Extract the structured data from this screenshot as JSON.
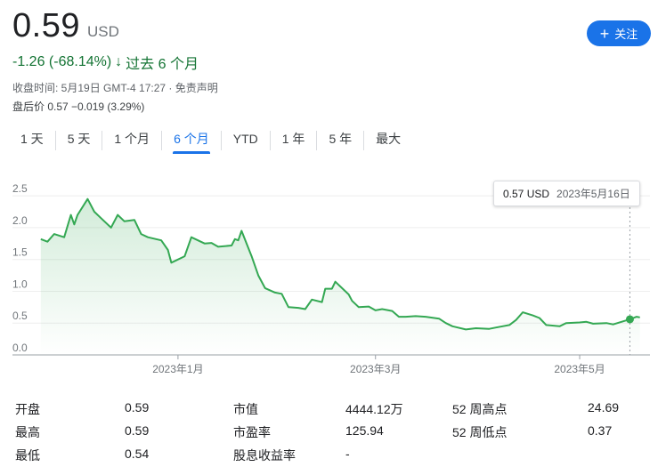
{
  "header": {
    "price": "0.59",
    "currency": "USD",
    "change": "-1.26 (-68.14%)",
    "change_arrow": "↓",
    "change_period": "过去 6 个月",
    "follow_label": "关注",
    "follow_icon": "plus-icon",
    "closing_time": "收盘时间: 5月19日 GMT-4 17:27 · 免责声明",
    "after_hours": "盘后价 0.57 −0.019 (3.29%)"
  },
  "tabs": [
    {
      "label": "1 天",
      "active": false
    },
    {
      "label": "5 天",
      "active": false
    },
    {
      "label": "1 个月",
      "active": false
    },
    {
      "label": "6 个月",
      "active": true
    },
    {
      "label": "YTD",
      "active": false
    },
    {
      "label": "1 年",
      "active": false
    },
    {
      "label": "5 年",
      "active": false
    },
    {
      "label": "最大",
      "active": false
    }
  ],
  "tooltip": {
    "price": "0.57 USD",
    "date": "2023年5月16日"
  },
  "colors": {
    "accent": "#1a73e8",
    "line": "#34a853",
    "positive": "#137333"
  },
  "chart_data": {
    "type": "area",
    "ylim": [
      0,
      2.6
    ],
    "y_ticks": [
      "0.0",
      "0.5",
      "1.0",
      "1.5",
      "2.0",
      "2.5"
    ],
    "x_tick_labels": [
      "2023年1月",
      "2023年3月",
      "2023年5月"
    ],
    "series": [
      {
        "x": [
          "2022-11-21",
          "2022-11-23",
          "2022-11-25",
          "2022-11-28",
          "2022-11-30",
          "2022-12-01",
          "2022-12-02",
          "2022-12-05",
          "2022-12-07",
          "2022-12-09",
          "2022-12-12",
          "2022-12-14",
          "2022-12-16",
          "2022-12-19",
          "2022-12-21",
          "2022-12-23",
          "2022-12-27",
          "2022-12-29",
          "2022-12-30",
          "2023-01-03",
          "2023-01-05",
          "2023-01-09",
          "2023-01-11",
          "2023-01-13",
          "2023-01-17",
          "2023-01-18",
          "2023-01-19",
          "2023-01-20",
          "2023-01-23",
          "2023-01-25",
          "2023-01-27",
          "2023-01-30",
          "2023-02-01",
          "2023-02-03",
          "2023-02-06",
          "2023-02-08",
          "2023-02-10",
          "2023-02-13",
          "2023-02-14",
          "2023-02-16",
          "2023-02-17",
          "2023-02-21",
          "2023-02-22",
          "2023-02-24",
          "2023-02-27",
          "2023-03-01",
          "2023-03-03",
          "2023-03-06",
          "2023-03-08",
          "2023-03-10",
          "2023-03-13",
          "2023-03-16",
          "2023-03-20",
          "2023-03-22",
          "2023-03-24",
          "2023-03-28",
          "2023-03-31",
          "2023-04-04",
          "2023-04-06",
          "2023-04-10",
          "2023-04-12",
          "2023-04-14",
          "2023-04-17",
          "2023-04-19",
          "2023-04-21",
          "2023-04-25",
          "2023-04-27",
          "2023-05-01",
          "2023-05-03",
          "2023-05-05",
          "2023-05-09",
          "2023-05-11",
          "2023-05-16",
          "2023-05-18",
          "2023-05-19"
        ],
        "y": [
          1.82,
          1.78,
          1.9,
          1.85,
          2.2,
          2.05,
          2.2,
          2.45,
          2.25,
          2.15,
          2.0,
          2.2,
          2.1,
          2.12,
          1.9,
          1.85,
          1.8,
          1.65,
          1.45,
          1.55,
          1.85,
          1.75,
          1.76,
          1.7,
          1.72,
          1.82,
          1.8,
          1.95,
          1.55,
          1.25,
          1.05,
          0.98,
          0.96,
          0.75,
          0.74,
          0.72,
          0.87,
          0.83,
          1.04,
          1.04,
          1.15,
          0.95,
          0.85,
          0.75,
          0.76,
          0.7,
          0.72,
          0.69,
          0.6,
          0.6,
          0.61,
          0.6,
          0.57,
          0.5,
          0.45,
          0.4,
          0.42,
          0.41,
          0.43,
          0.47,
          0.55,
          0.67,
          0.62,
          0.58,
          0.47,
          0.45,
          0.5,
          0.51,
          0.52,
          0.49,
          0.5,
          0.48,
          0.56,
          0.6,
          0.59
        ]
      }
    ]
  },
  "stats": {
    "open_label": "开盘",
    "open": "0.59",
    "high_label": "最高",
    "high": "0.59",
    "low_label": "最低",
    "low": "0.54",
    "mktcap_label": "市值",
    "mktcap": "4444.12万",
    "pe_label": "市盈率",
    "pe": "125.94",
    "yield_label": "股息收益率",
    "yield": "-",
    "w52high_label": "52 周高点",
    "w52high": "24.69",
    "w52low_label": "52 周低点",
    "w52low": "0.37"
  }
}
